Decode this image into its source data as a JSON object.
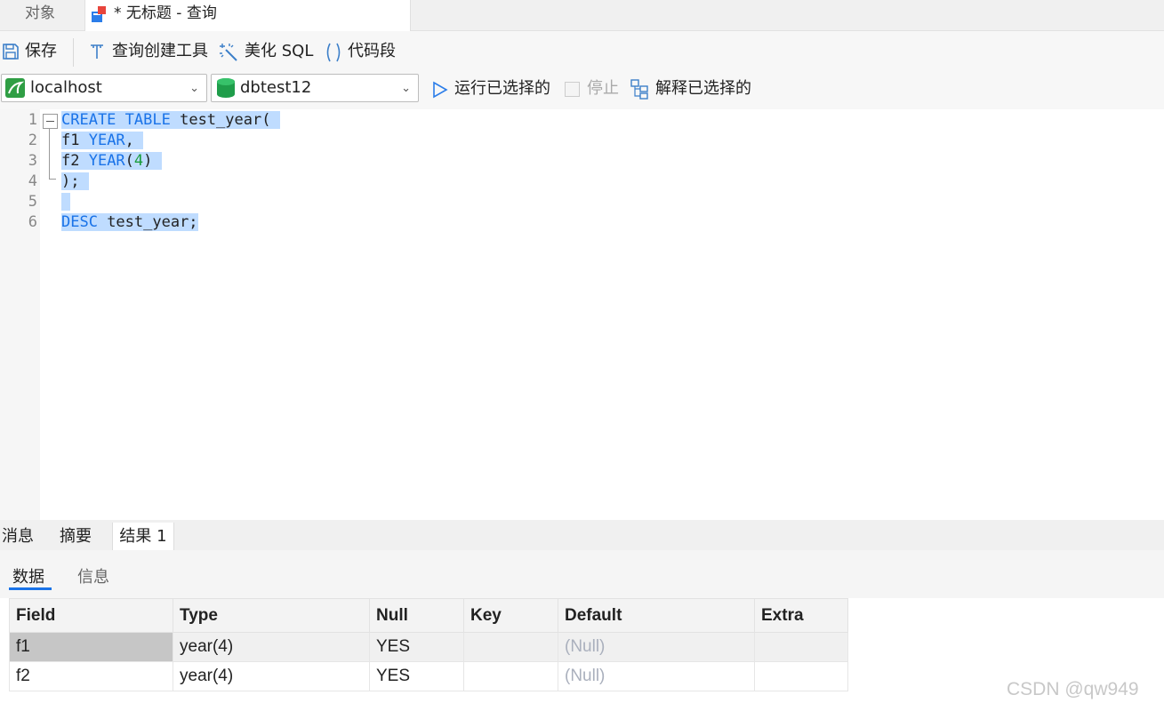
{
  "tabs": {
    "objects_label": "对象",
    "query_label": "* 无标题 - 查询"
  },
  "toolbar": {
    "save_label": "保存",
    "query_builder_label": "查询创建工具",
    "beautify_label": "美化 SQL",
    "snippet_label": "代码段"
  },
  "connection": {
    "server": "localhost",
    "database": "dbtest12",
    "run_selected_label": "运行已选择的",
    "stop_label": "停止",
    "explain_selected_label": "解释已选择的"
  },
  "editor": {
    "line_numbers": [
      "1",
      "2",
      "3",
      "4",
      "5",
      "6"
    ]
  },
  "bottom": {
    "tabs": [
      "消息",
      "摘要",
      "结果 1"
    ],
    "subtabs": [
      "数据",
      "信息"
    ]
  },
  "grid": {
    "columns": [
      "Field",
      "Type",
      "Null",
      "Key",
      "Default",
      "Extra"
    ],
    "rows": [
      [
        "f1",
        "year(4)",
        "YES",
        "",
        "(Null)",
        ""
      ],
      [
        "f2",
        "year(4)",
        "YES",
        "",
        "(Null)",
        ""
      ]
    ]
  },
  "watermark": "CSDN @qw949",
  "colors": {
    "accent": "#1a73e8",
    "selection": "#bfdcff",
    "keyword": "#1a73e8",
    "number": "#1a9c3c"
  }
}
